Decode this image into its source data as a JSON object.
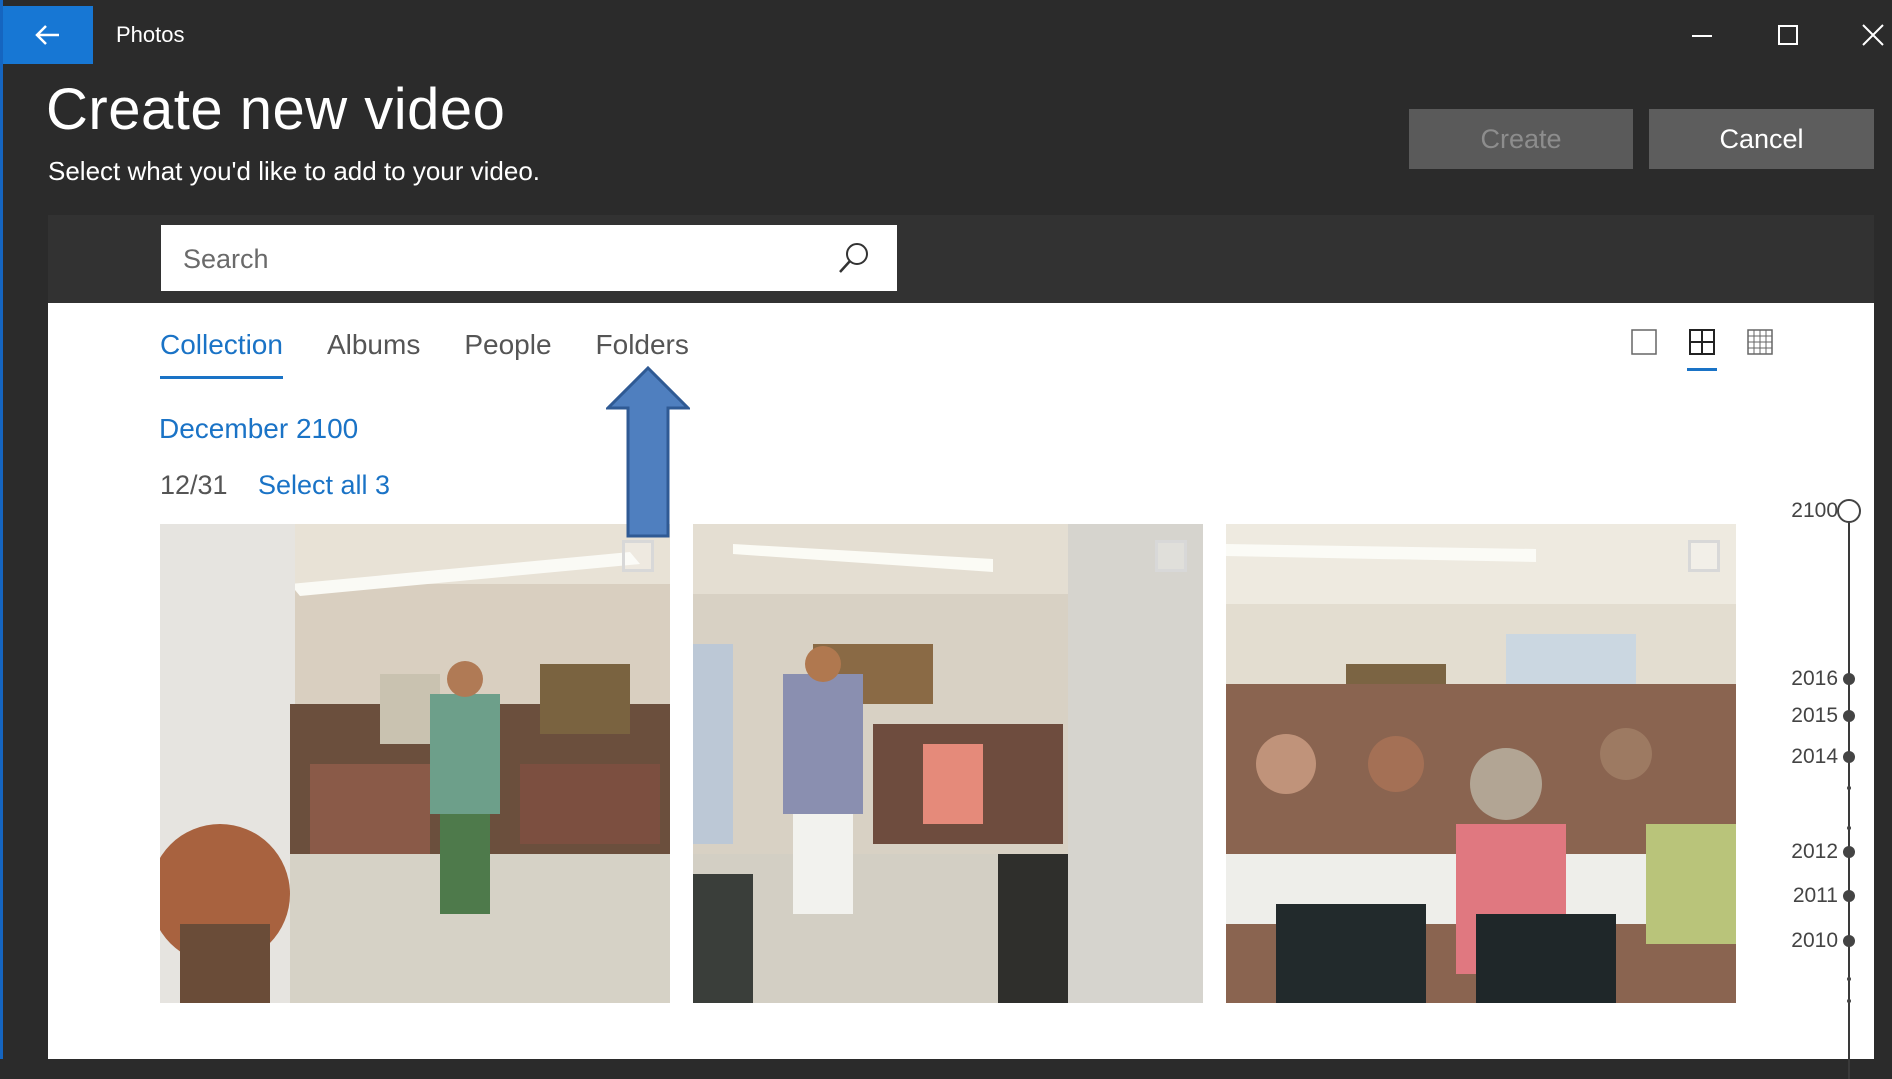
{
  "window": {
    "app_title": "Photos",
    "controls": [
      "minimize-icon",
      "maximize-icon",
      "close-icon"
    ],
    "accent_color": "#1777d4"
  },
  "header": {
    "title": "Create new video",
    "subtitle": "Select what you'd like to add to your video.",
    "create_label": "Create",
    "cancel_label": "Cancel"
  },
  "search": {
    "placeholder": "Search",
    "value": ""
  },
  "tabs": [
    {
      "label": "Collection",
      "active": true
    },
    {
      "label": "Albums",
      "active": false
    },
    {
      "label": "People",
      "active": false
    },
    {
      "label": "Folders",
      "active": false
    }
  ],
  "view_options": [
    {
      "name": "single-view-icon",
      "active": false
    },
    {
      "name": "medium-grid-icon",
      "active": true
    },
    {
      "name": "small-grid-icon",
      "active": false
    }
  ],
  "collection": {
    "month": "December 2100",
    "date": "12/31",
    "select_all": "Select all 3",
    "photos": [
      {
        "name": "photo-party-woman-green",
        "selected": false
      },
      {
        "name": "photo-party-woman-white-pants",
        "selected": false
      },
      {
        "name": "photo-party-crowd-tables",
        "selected": false
      }
    ]
  },
  "timeline": {
    "years": [
      "2100",
      "2016",
      "2015",
      "2014",
      "2012",
      "2011",
      "2010"
    ]
  }
}
